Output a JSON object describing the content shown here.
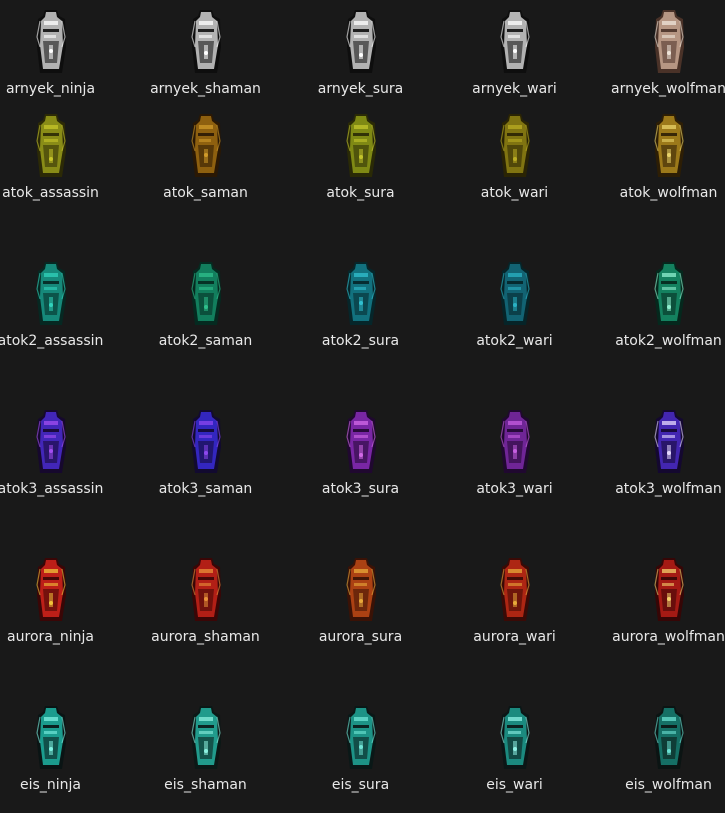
{
  "rows": [
    {
      "items": [
        {
          "name": "arnyek_ninja",
          "palette": [
            "#0e0e0e",
            "#cfcfcf",
            "#ffffff"
          ],
          "icon": "armor-thumbnail"
        },
        {
          "name": "arnyek_shaman",
          "palette": [
            "#0e0e0e",
            "#cfcfcf",
            "#ffffff"
          ],
          "icon": "armor-thumbnail"
        },
        {
          "name": "arnyek_sura",
          "palette": [
            "#0e0e0e",
            "#cfcfcf",
            "#ffffff"
          ],
          "icon": "armor-thumbnail"
        },
        {
          "name": "arnyek_wari",
          "palette": [
            "#0e0e0e",
            "#cfcfcf",
            "#ffffff"
          ],
          "icon": "armor-thumbnail"
        },
        {
          "name": "arnyek_wolfman",
          "palette": [
            "#4a3228",
            "#c9a893",
            "#efe4d9"
          ],
          "icon": "armor-thumbnail"
        }
      ]
    },
    {
      "items": [
        {
          "name": "atok_assassin",
          "palette": [
            "#2c2a06",
            "#9a9d1b",
            "#c7c52a"
          ],
          "icon": "armor-thumbnail"
        },
        {
          "name": "atok_saman",
          "palette": [
            "#2a1804",
            "#a06d12",
            "#cf9a2a"
          ],
          "icon": "armor-thumbnail"
        },
        {
          "name": "atok_sura",
          "palette": [
            "#2a2a06",
            "#8e9a17",
            "#c3c52b"
          ],
          "icon": "armor-thumbnail"
        },
        {
          "name": "atok_wari",
          "palette": [
            "#2a2404",
            "#8f8314",
            "#b9ac22"
          ],
          "icon": "armor-thumbnail"
        },
        {
          "name": "atok_wolfman",
          "palette": [
            "#2d1e05",
            "#b08a1f",
            "#e9d36a"
          ],
          "icon": "armor-thumbnail"
        }
      ]
    },
    {
      "items": [
        {
          "name": "atok2_assassin",
          "palette": [
            "#062822",
            "#1a9a8a",
            "#31d3bc"
          ],
          "icon": "armor-thumbnail"
        },
        {
          "name": "atok2_saman",
          "palette": [
            "#052a20",
            "#158d68",
            "#2fc08c"
          ],
          "icon": "armor-thumbnail"
        },
        {
          "name": "atok2_sura",
          "palette": [
            "#06262a",
            "#157f8d",
            "#31c0d0"
          ],
          "icon": "armor-thumbnail"
        },
        {
          "name": "atok2_wari",
          "palette": [
            "#062428",
            "#156f80",
            "#2ab2c4"
          ],
          "icon": "armor-thumbnail"
        },
        {
          "name": "atok2_wolfman",
          "palette": [
            "#05281d",
            "#18906b",
            "#8ff0cf"
          ],
          "icon": "armor-thumbnail"
        }
      ]
    },
    {
      "items": [
        {
          "name": "atok3_assassin",
          "palette": [
            "#16082e",
            "#4a2bd0",
            "#a34ef0"
          ],
          "icon": "armor-thumbnail"
        },
        {
          "name": "atok3_saman",
          "palette": [
            "#120a30",
            "#3a2bd8",
            "#8d47ef"
          ],
          "icon": "armor-thumbnail"
        },
        {
          "name": "atok3_sura",
          "palette": [
            "#200830",
            "#8a2bb8",
            "#d36ae8"
          ],
          "icon": "armor-thumbnail"
        },
        {
          "name": "atok3_wari",
          "palette": [
            "#200830",
            "#7e2aa8",
            "#c65ee0"
          ],
          "icon": "armor-thumbnail"
        },
        {
          "name": "atok3_wolfman",
          "palette": [
            "#140830",
            "#4b2cc8",
            "#e6d9ff"
          ],
          "icon": "armor-thumbnail"
        }
      ]
    },
    {
      "items": [
        {
          "name": "aurora_ninja",
          "palette": [
            "#3a0606",
            "#d4251c",
            "#f0c33a"
          ],
          "icon": "armor-thumbnail"
        },
        {
          "name": "aurora_shaman",
          "palette": [
            "#3a0606",
            "#c8251a",
            "#e8913a"
          ],
          "icon": "armor-thumbnail"
        },
        {
          "name": "aurora_sura",
          "palette": [
            "#3a1206",
            "#c04a16",
            "#e8a83a"
          ],
          "icon": "armor-thumbnail"
        },
        {
          "name": "aurora_wari",
          "palette": [
            "#3a0a06",
            "#c22b16",
            "#e8a93a"
          ],
          "icon": "armor-thumbnail"
        },
        {
          "name": "aurora_wolfman",
          "palette": [
            "#360606",
            "#b71e18",
            "#f3cf6b"
          ],
          "icon": "armor-thumbnail"
        }
      ]
    },
    {
      "items": [
        {
          "name": "eis_ninja",
          "palette": [
            "#0a1414",
            "#1fb4a3",
            "#7ff2e2"
          ],
          "icon": "armor-thumbnail"
        },
        {
          "name": "eis_shaman",
          "palette": [
            "#0b1816",
            "#26b3a1",
            "#8cf0df"
          ],
          "icon": "armor-thumbnail"
        },
        {
          "name": "eis_sura",
          "palette": [
            "#0a1817",
            "#21a99a",
            "#6fe6d6"
          ],
          "icon": "armor-thumbnail"
        },
        {
          "name": "eis_wari",
          "palette": [
            "#0b1616",
            "#1f9f92",
            "#8ff2e6"
          ],
          "icon": "armor-thumbnail"
        },
        {
          "name": "eis_wolfman",
          "palette": [
            "#0b1413",
            "#187f74",
            "#6ae0d2"
          ],
          "icon": "armor-thumbnail"
        }
      ]
    }
  ]
}
